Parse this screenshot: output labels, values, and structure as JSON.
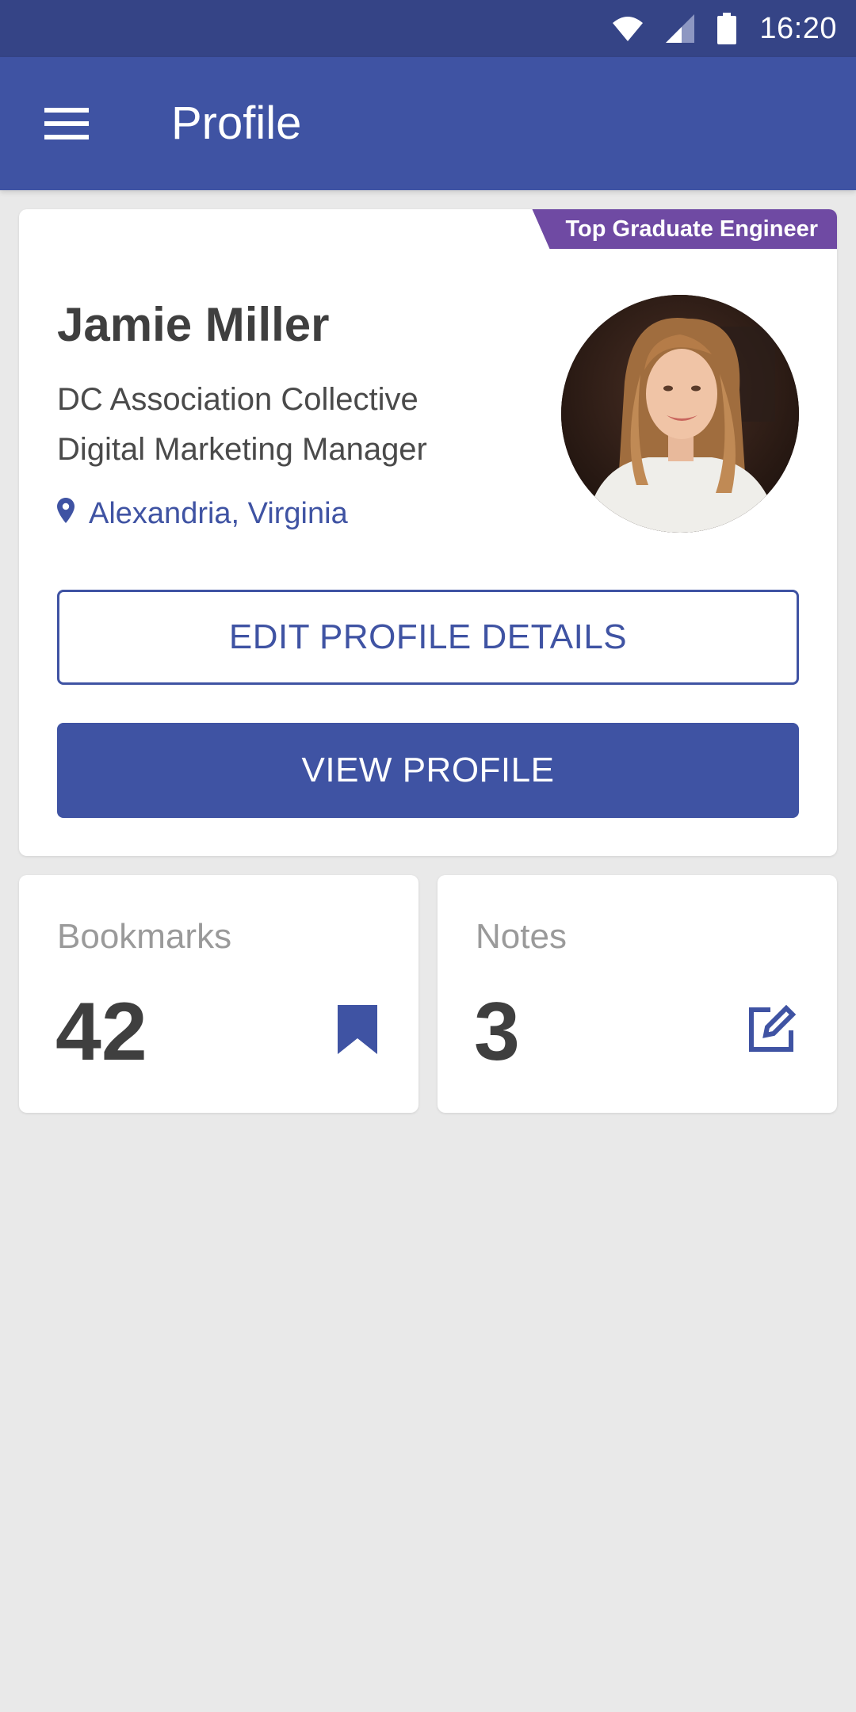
{
  "status_bar": {
    "time": "16:20",
    "icons": [
      "wifi-icon",
      "signal-icon",
      "battery-icon"
    ]
  },
  "app_bar": {
    "title": "Profile",
    "menu_icon": "menu-icon"
  },
  "profile": {
    "badge": "Top Graduate Engineer",
    "name": "Jamie Miller",
    "company": "DC Association Collective",
    "role": "Digital Marketing Manager",
    "location": "Alexandria, Virginia",
    "location_icon": "location-pin-icon",
    "avatar_icon": "profile-photo",
    "edit_button": "EDIT PROFILE DETAILS",
    "view_button": "VIEW PROFILE"
  },
  "stats": [
    {
      "label": "Bookmarks",
      "value": "42",
      "icon": "bookmark-icon"
    },
    {
      "label": "Notes",
      "value": "3",
      "icon": "edit-note-icon"
    }
  ],
  "colors": {
    "primary": "#3f53a3",
    "status_bar": "#354486",
    "badge": "#6f4aa3",
    "background": "#e9e9e9",
    "text_dark": "#3f3f3f",
    "text_muted": "#9a9a9a"
  }
}
